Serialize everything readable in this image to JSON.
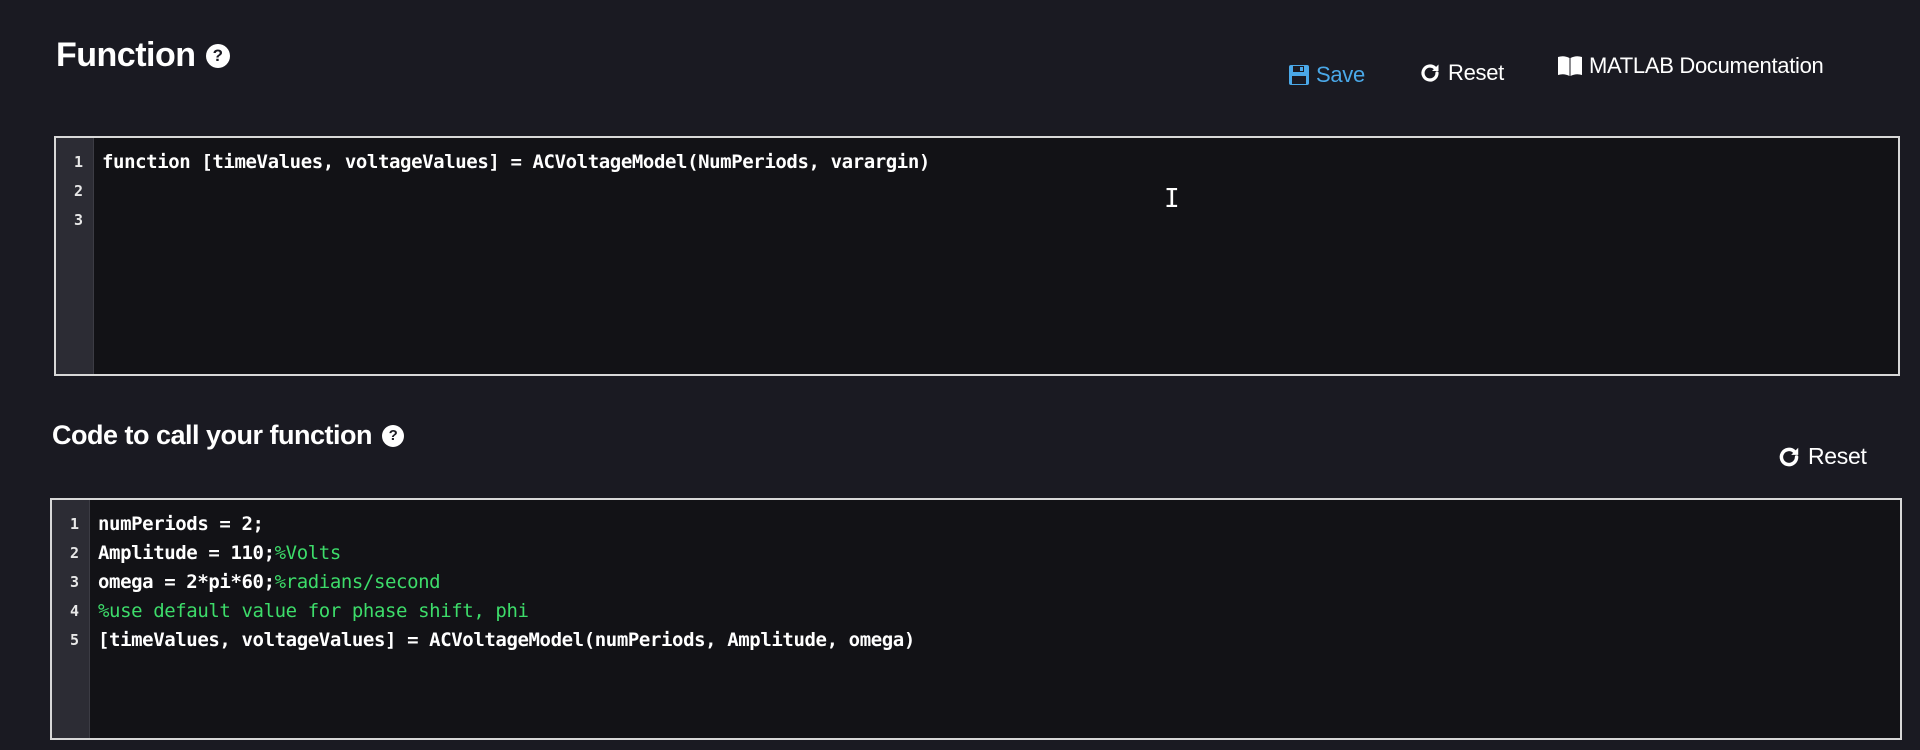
{
  "function_section": {
    "title": "Function",
    "help_label": "?",
    "toolbar": {
      "save_label": "Save",
      "reset_label": "Reset",
      "docs_label": "MATLAB Documentation"
    },
    "editor": {
      "lines": [
        {
          "number": "1",
          "code": "function [timeValues, voltageValues] = ACVoltageModel(NumPeriods, varargin)",
          "comment": ""
        },
        {
          "number": "2",
          "code": "",
          "comment": ""
        },
        {
          "number": "3",
          "code": "",
          "comment": ""
        }
      ]
    }
  },
  "call_section": {
    "title": "Code to call your function",
    "help_label": "?",
    "toolbar": {
      "reset_label": "Reset"
    },
    "editor": {
      "lines": [
        {
          "number": "1",
          "code": "numPeriods = 2;",
          "comment": ""
        },
        {
          "number": "2",
          "code": "Amplitude = 110;",
          "comment": "%Volts"
        },
        {
          "number": "3",
          "code": "omega = 2*pi*60;",
          "comment": "%radians/second"
        },
        {
          "number": "4",
          "code": "",
          "comment": "%use default value for phase shift, phi"
        },
        {
          "number": "5",
          "code": "[timeValues, voltageValues] = ACVoltageModel(numPeriods, Amplitude, omega)",
          "comment": ""
        }
      ]
    }
  },
  "colors": {
    "background": "#1a1a22",
    "editor_background": "#121216",
    "gutter": "#2c2c34",
    "save_accent": "#4aa8e8",
    "comment": "#3ddc6a"
  },
  "icons": {
    "save": "floppy-disk-icon",
    "reset": "refresh-icon",
    "docs": "book-icon",
    "help": "question-circle-icon"
  }
}
